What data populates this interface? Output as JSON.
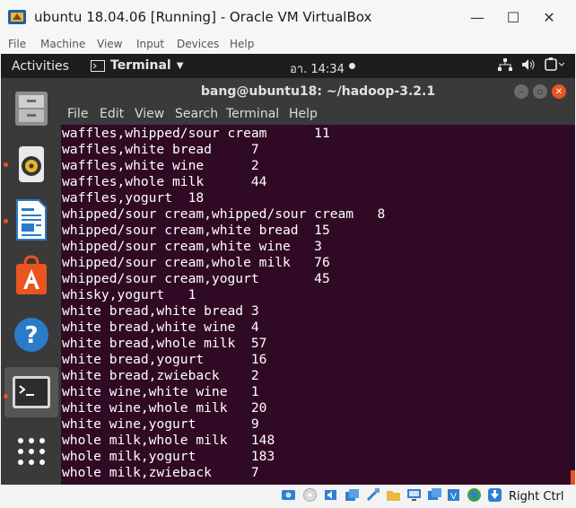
{
  "window": {
    "title": "ubuntu 18.04.06 [Running] - Oracle VM VirtualBox",
    "minimize": "—",
    "maximize": "☐",
    "close": "✕"
  },
  "vbox_menu": [
    "File",
    "Machine",
    "View",
    "Input",
    "Devices",
    "Help"
  ],
  "top_bar": {
    "activities": "Activities",
    "app_menu": "Terminal",
    "clock": "อา. 14:34"
  },
  "terminal": {
    "title": "bang@ubuntu18: ~/hadoop-3.2.1",
    "menu": [
      "File",
      "Edit",
      "View",
      "Search",
      "Terminal",
      "Help"
    ],
    "lines": [
      "waffles,whipped/sour cream      11",
      "waffles,white bread     7",
      "waffles,white wine      2",
      "waffles,whole milk      44",
      "waffles,yogurt  18",
      "whipped/sour cream,whipped/sour cream   8",
      "whipped/sour cream,white bread  15",
      "whipped/sour cream,white wine   3",
      "whipped/sour cream,whole milk   76",
      "whipped/sour cream,yogurt       45",
      "whisky,yogurt   1",
      "white bread,white bread 3",
      "white bread,white wine  4",
      "white bread,whole milk  57",
      "white bread,yogurt      16",
      "white bread,zwieback    2",
      "white wine,white wine   1",
      "white wine,whole milk   20",
      "white wine,yogurt       9",
      "whole milk,whole milk   148",
      "whole milk,yogurt       183",
      "whole milk,zwieback     7"
    ]
  },
  "dock": [
    "files-icon",
    "rhythmbox-icon",
    "writer-icon",
    "software-center-icon",
    "help-icon",
    "terminal-icon",
    "show-apps-icon"
  ],
  "status_bar": {
    "host_key": "Right Ctrl"
  },
  "colors": {
    "terminal_bg": "#300a24",
    "accent": "#e95420",
    "panel": "#3a3a3a"
  }
}
